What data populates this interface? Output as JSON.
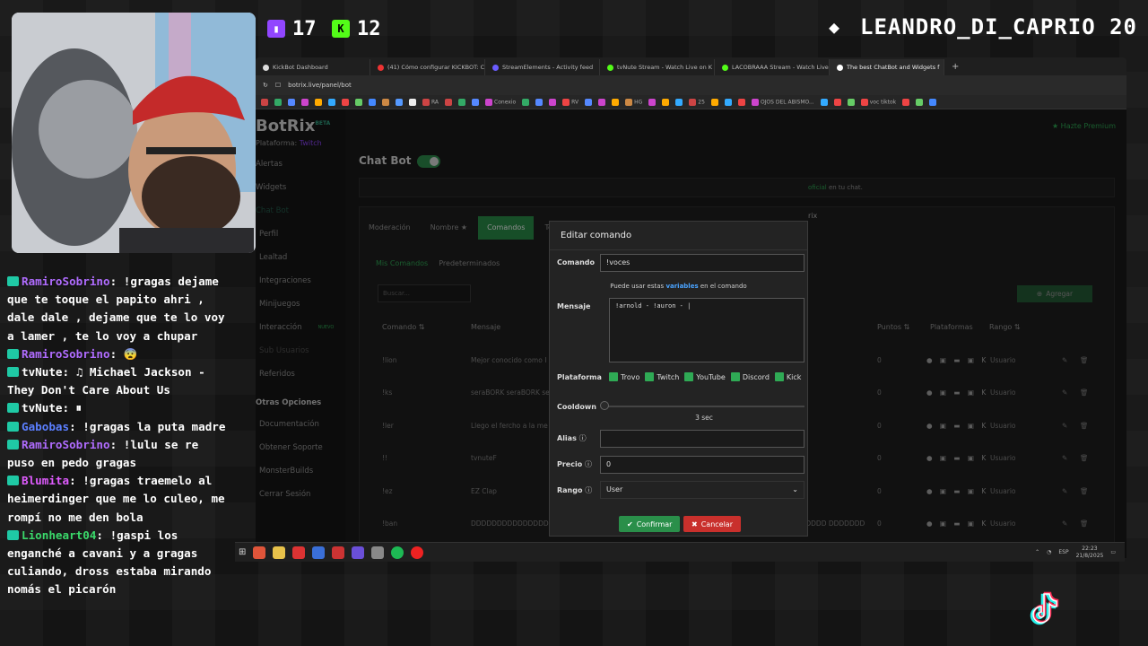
{
  "stream": {
    "twitch_count": "17",
    "kick_count": "12",
    "username": "LEANDRO_DI_CAPRIO",
    "user_number": "20"
  },
  "chat": [
    {
      "user": "RamiroSobrino",
      "text": ": !gragas dejame que te toque el papito ahri , dale dale , dejame que te lo voy a lamer , te lo voy a chupar",
      "color": "#b06cff"
    },
    {
      "user": "RamiroSobrino",
      "text": ": 😨",
      "color": "#b06cff"
    },
    {
      "user": "tvNute",
      "text": ": ♫ Michael Jackson - They Don't Care About Us",
      "color": "#ffffff"
    },
    {
      "user": "tvNute",
      "text": ": ⏸",
      "color": "#ffffff"
    },
    {
      "user": "Gabobas",
      "text": ": !gragas la puta madre",
      "color": "#5b7fff"
    },
    {
      "user": "RamiroSobrino",
      "text": ": !lulu se re puso en pedo gragas",
      "color": "#b06cff"
    },
    {
      "user": "Blumita",
      "text": ": !gragas traemelo al heimerdinger que me lo culeo, me rompí no me den bola",
      "color": "#e05cff"
    },
    {
      "user": "Lionheart04",
      "text": ": !gaspi los enganché a cavani y a gragas culiando, dross estaba mirando nomás el picarón",
      "color": "#3ad96a"
    }
  ],
  "browser": {
    "tabs": [
      "KickBot Dashboard",
      "(41) Cómo configurar KICKBOT: Ch",
      "StreamElements - Activity feed",
      "tvNute Stream - Watch Live on K",
      "LACOBRAAA Stream - Watch Live",
      "The best ChatBot and Widgets f"
    ],
    "url": "botrix.live/panel/bot",
    "bookmarks": [
      "RA",
      "Conexio",
      "RV",
      "HG",
      "25",
      "OJOS DEL ABISMO...",
      "voc tiktok"
    ]
  },
  "app": {
    "logo": "BotRix",
    "logo_badge": "BETA",
    "platform_label": "Plataforma:",
    "platform_value": "Twitch",
    "premium": "Hazte Premium",
    "sidebar": [
      "Alertas",
      "Widgets",
      "Chat Bot",
      "Perfil",
      "Lealtad",
      "Integraciones",
      "Minijuegos",
      "Interacción",
      "Sub Usuarios",
      "Referidos"
    ],
    "sidebar_new_badge": "NUEVO",
    "other_section": "Otras Opciones",
    "other": [
      "Documentación",
      "Obtener Soporte",
      "MonsterBuilds",
      "Cerrar Sesión"
    ],
    "page_title": "Chat Bot",
    "banner_text": "oficial",
    "banner_suffix": "en tu chat.",
    "banner_right": "rix",
    "tabs": [
      "Moderación",
      "Nombre ★",
      "Comandos",
      "Tem"
    ],
    "subtabs": [
      "Mis Comandos",
      "Predeterminados"
    ],
    "search_placeholder": "Buscar...",
    "add_button": "Agregar",
    "columns": [
      "Comando ⇅",
      "Mensaje",
      "Puntos ⇅",
      "Plataformas",
      "Rango ⇅"
    ],
    "rows": [
      {
        "cmd": "!lion",
        "msg": "Mejor conocido como I",
        "pts": "0",
        "rank": "Usuario"
      },
      {
        "cmd": "!ks",
        "msg": "seraBORK seraBORK se",
        "pts": "0",
        "rank": "Usuario"
      },
      {
        "cmd": "!ler",
        "msg": "Llego el fercho a la me",
        "pts": "0",
        "rank": "Usuario"
      },
      {
        "cmd": "!!",
        "msg": "tvnuteF",
        "pts": "0",
        "rank": "Usuario"
      },
      {
        "cmd": "!ez",
        "msg": "EZ Clap",
        "pts": "0",
        "rank": "Usuario"
      },
      {
        "cmd": "!ban",
        "msg": "DDDDDDDDDDDDDDDDD DDDDDDDD DDDDDDDDDDDDDDDD DDDDDDDDDDDDDDDDDD DDDDDDDD DDDDDDDDDDDDDDDD ...",
        "pts": "0",
        "rank": "Usuario"
      }
    ]
  },
  "modal": {
    "title": "Editar comando",
    "comando_label": "Comando",
    "comando_value": "!voces",
    "vars_hint_pre": "Puede usar estas",
    "vars_hint_link": "variables",
    "vars_hint_post": "en el comando",
    "mensaje_label": "Mensaje",
    "mensaje_value": "!arnold - !auron - |",
    "plataforma_label": "Plataforma",
    "platforms": [
      "Trovo",
      "Twitch",
      "YouTube",
      "Discord",
      "Kick"
    ],
    "cooldown_label": "Cooldown",
    "cooldown_value": "3 sec",
    "cooldown_fraction": 0.0,
    "alias_label": "Alias",
    "alias_value": "",
    "precio_label": "Precio",
    "precio_value": "0",
    "rango_label": "Rango",
    "rango_value": "User",
    "confirm": "Confirmar",
    "cancel": "Cancelar"
  },
  "taskbar": {
    "lang": "ESP",
    "time": "22:23",
    "date": "21/8/2025"
  }
}
